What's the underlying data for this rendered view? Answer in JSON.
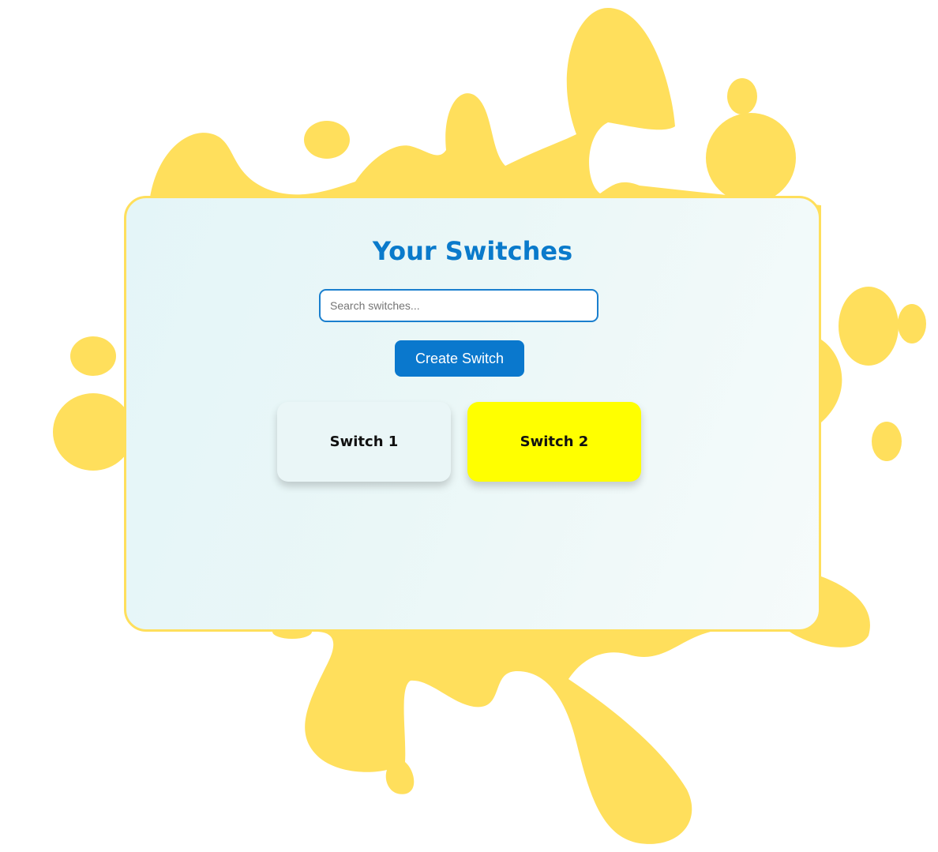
{
  "page": {
    "title": "Your Switches"
  },
  "search": {
    "placeholder": "Search switches..."
  },
  "actions": {
    "create_label": "Create Switch"
  },
  "switches": [
    {
      "label": "Switch 1",
      "color": "#eaf6f7"
    },
    {
      "label": "Switch 2",
      "color": "#ffff00"
    }
  ],
  "colors": {
    "splash": "#ffdf5c",
    "accent": "#0a78cd",
    "title": "#0a7acb"
  }
}
